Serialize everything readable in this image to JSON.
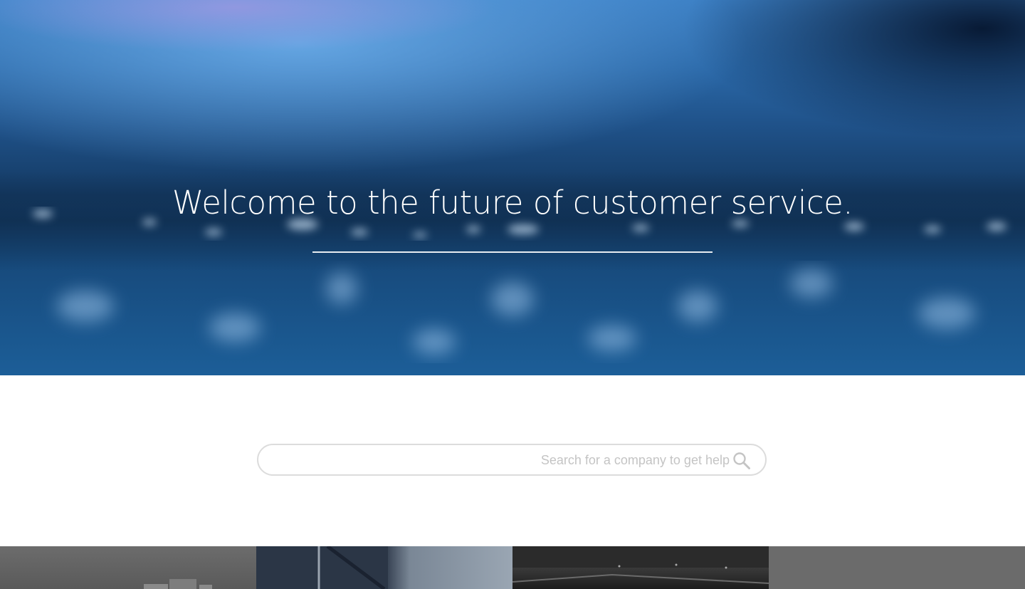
{
  "hero": {
    "title": "Welcome to the future of customer service."
  },
  "search": {
    "placeholder": "Search for a company to get help",
    "value": "",
    "icon": "search-icon"
  },
  "tiles": [
    {
      "name": "city-skyline-tile"
    },
    {
      "name": "building-canopy-tile"
    },
    {
      "name": "dark-ceiling-tile"
    },
    {
      "name": "grey-tile"
    }
  ],
  "colors": {
    "hero_blue": "#1f5188",
    "search_border": "#dcdcdc",
    "placeholder": "#c4c4c4",
    "hero_text": "#ffffff"
  }
}
